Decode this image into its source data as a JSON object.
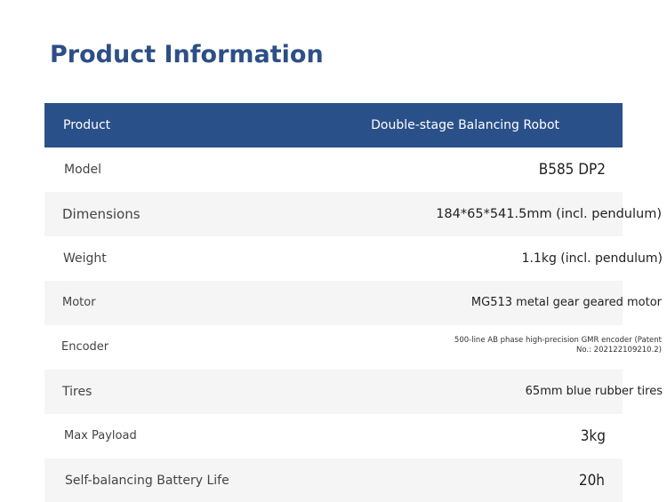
{
  "title": "Product Information",
  "header": {
    "label": "Product",
    "value": "Double-stage Balancing Robot"
  },
  "rows": [
    {
      "label": "Model",
      "value": "B585 DP2"
    },
    {
      "label": "Dimensions",
      "value": "184*65*541.5mm (incl. pendulum)"
    },
    {
      "label": "Weight",
      "value": "1.1kg (incl. pendulum)"
    },
    {
      "label": "Motor",
      "value": "MG513 metal gear geared motor"
    },
    {
      "label": "Encoder",
      "value": "500-line AB phase high-precision GMR encoder (Patent No.: 202122109210.2)"
    },
    {
      "label": "Tires",
      "value": "65mm blue rubber tires"
    },
    {
      "label": "Max Payload",
      "value": "3kg"
    },
    {
      "label": "Self-balancing Battery Life",
      "value": "20h"
    }
  ],
  "colors": {
    "title": "#2d4f86",
    "header_bg": "#2a5089",
    "row_shade": "#f5f5f5"
  }
}
